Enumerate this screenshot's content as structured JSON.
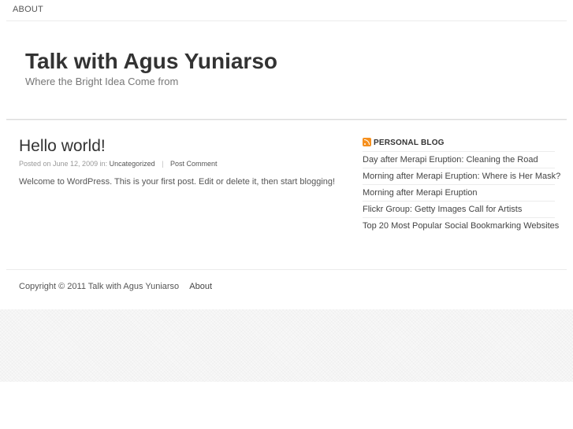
{
  "nav": {
    "about": "ABOUT"
  },
  "header": {
    "title": "Talk with Agus Yuniarso",
    "description": "Where the Bright Idea Come from"
  },
  "post": {
    "title": "Hello world!",
    "meta_prefix": "Posted on June 12, 2009 in:",
    "category": "Uncategorized",
    "separator": "|",
    "comment_link": "Post Comment",
    "body": "Welcome to WordPress. This is your first post. Edit or delete it, then start blogging!"
  },
  "sidebar": {
    "widget_title": "PERSONAL BLOG",
    "rss_icon": "rss-icon",
    "items": [
      "Day after Merapi Eruption: Cleaning the Road",
      "Morning after Merapi Eruption: Where is Her Mask?",
      "Morning after Merapi Eruption",
      "Flickr Group: Getty Images Call for Artists",
      "Top 20 Most Popular Social Bookmarking Websites"
    ]
  },
  "footer": {
    "copyright": "Copyright © 2011 Talk with Agus Yuniarso",
    "about": "About"
  },
  "colors": {
    "rss": "#f6901e",
    "text": "#333333"
  }
}
